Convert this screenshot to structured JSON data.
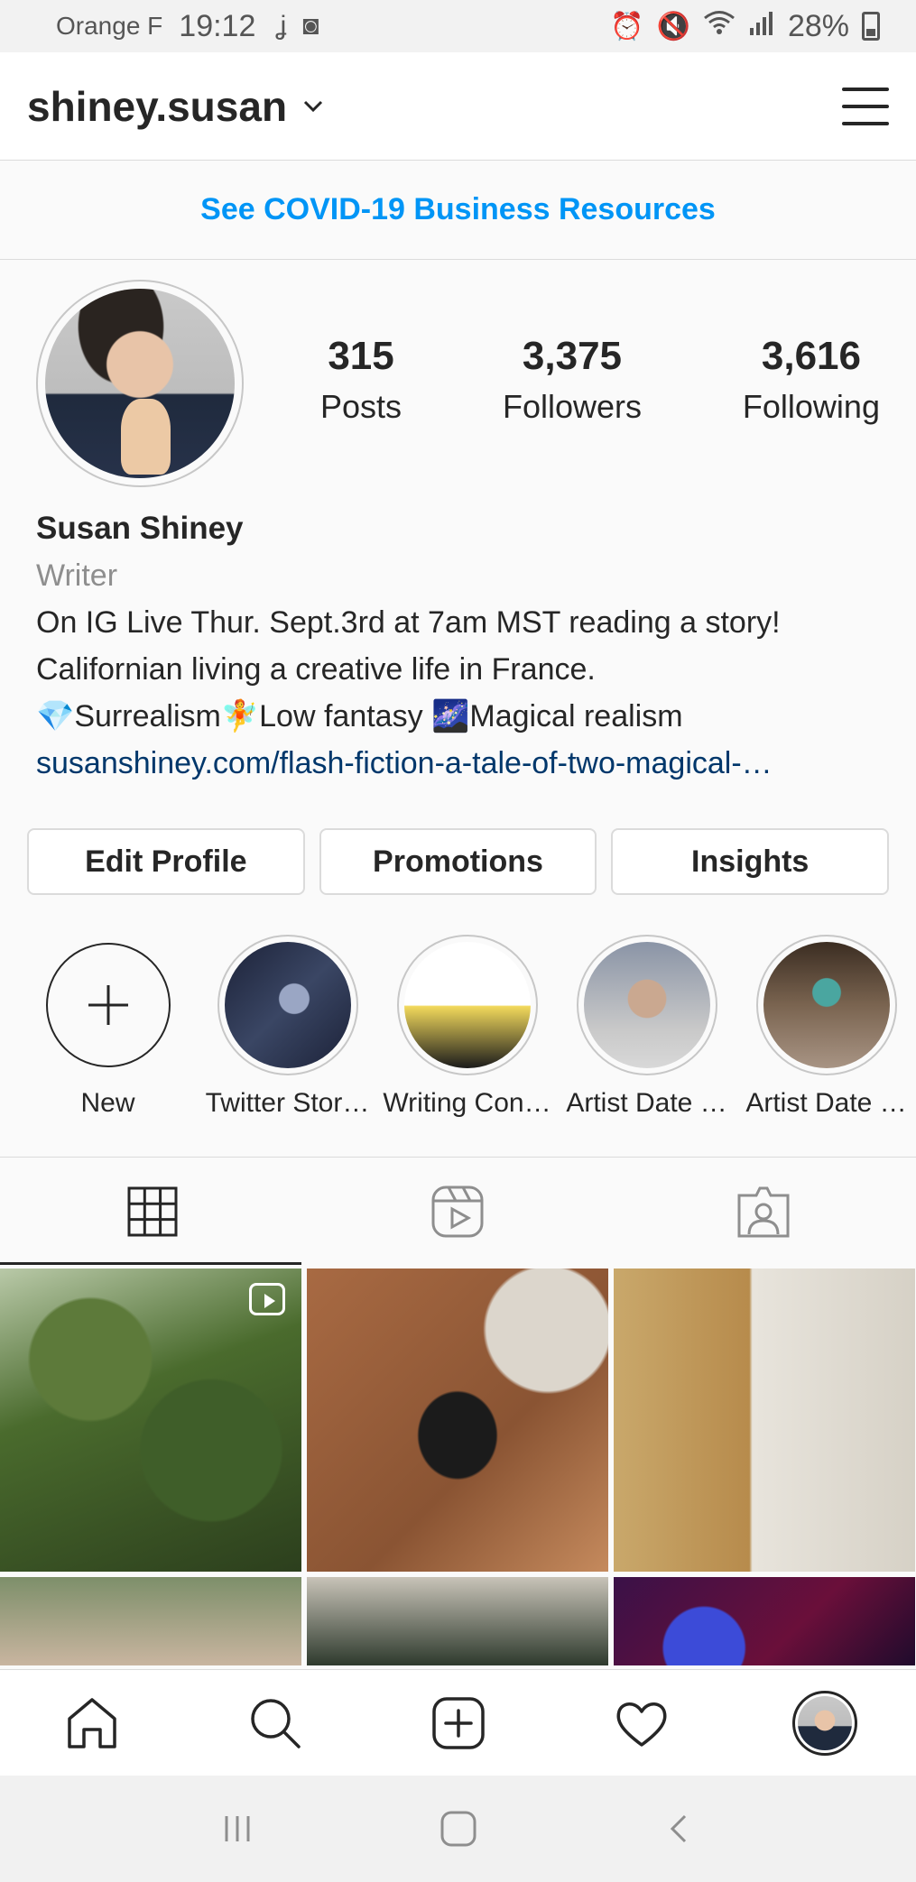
{
  "status_bar": {
    "carrier": "Orange F",
    "time": "19:12",
    "battery": "28%"
  },
  "header": {
    "username": "shiney.susan"
  },
  "banner": {
    "text": "See COVID-19 Business Resources"
  },
  "profile": {
    "stats": [
      {
        "value": "315",
        "label": "Posts"
      },
      {
        "value": "3,375",
        "label": "Followers"
      },
      {
        "value": "3,616",
        "label": "Following"
      }
    ],
    "name": "Susan Shiney",
    "category": "Writer",
    "bio_line1": "On IG Live Thur. Sept.3rd at 7am MST reading a story!",
    "bio_line2": "Californian living a creative life in France.",
    "bio_line3": "💎Surrealism🧚Low fantasy 🌌Magical realism",
    "link": "susanshiney.com/flash-fiction-a-tale-of-two-magical-…"
  },
  "buttons": {
    "edit_profile": "Edit Profile",
    "promotions": "Promotions",
    "insights": "Insights"
  },
  "highlights": [
    {
      "label": "New",
      "icon": "plus-icon"
    },
    {
      "label": "Twitter Stor…",
      "color": "#2b3348"
    },
    {
      "label": "Writing Con…",
      "color": "#f2d95c"
    },
    {
      "label": "Artist Date …",
      "color": "#9aa0a8"
    },
    {
      "label": "Artist Date …",
      "color": "#5b4a3a"
    }
  ],
  "tabs": [
    {
      "name": "grid-icon",
      "active": true
    },
    {
      "name": "reels-icon",
      "active": false
    },
    {
      "name": "tagged-icon",
      "active": false
    }
  ],
  "bottom_nav": [
    "home-icon",
    "search-icon",
    "new-post-icon",
    "activity-heart-icon",
    "profile-avatar"
  ],
  "colors": {
    "link_blue": "#0095f6",
    "bio_link": "#00376b",
    "text": "#262626",
    "secondary": "#8e8e8e"
  }
}
